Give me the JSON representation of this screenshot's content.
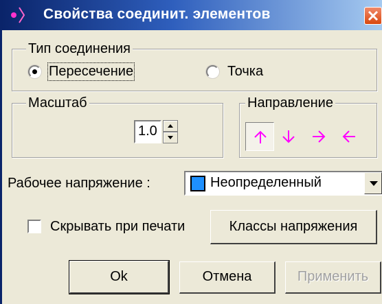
{
  "window": {
    "title": "Свойства соединит. элементов"
  },
  "connection_type": {
    "legend": "Тип соединения",
    "options": [
      {
        "label": "Пересечение",
        "selected": true
      },
      {
        "label": "Точка",
        "selected": false
      }
    ]
  },
  "scale": {
    "legend": "Масштаб",
    "value": "1.0"
  },
  "direction": {
    "legend": "Направление",
    "icons": [
      "arrow-up-icon",
      "arrow-down-icon",
      "arrow-right-icon",
      "arrow-left-icon"
    ],
    "selected_index": 0,
    "arrow_color": "#ff00ff"
  },
  "voltage": {
    "label": "Рабочее напряжение :",
    "value": "Неопределенный",
    "swatch_color": "#1e90ff"
  },
  "hide_print": {
    "label": "Скрывать при печати",
    "checked": false
  },
  "buttons": {
    "classes": "Классы напряжения",
    "ok": "Ok",
    "cancel": "Отмена",
    "apply": "Применить"
  },
  "colors": {
    "titlebar_start": "#0a246a",
    "titlebar_end": "#a6caf0",
    "face": "#ece9d8"
  }
}
